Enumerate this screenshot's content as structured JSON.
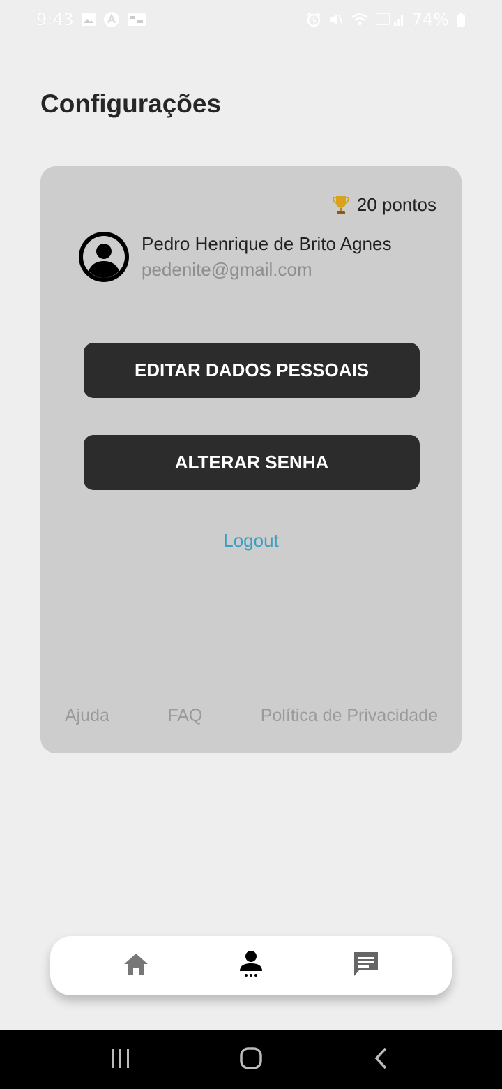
{
  "status_bar": {
    "time": "9:43",
    "battery": "74%"
  },
  "page": {
    "title": "Configurações"
  },
  "profile": {
    "points": "20 pontos",
    "name": "Pedro Henrique de Brito Agnes",
    "email": "pedenite@gmail.com"
  },
  "actions": {
    "edit_label": "EDITAR DADOS PESSOAIS",
    "password_label": "ALTERAR SENHA",
    "logout_label": "Logout"
  },
  "footer": {
    "help": "Ajuda",
    "faq": "FAQ",
    "privacy": "Política de Privacidade"
  },
  "bottom_nav": {
    "items": [
      "home-icon",
      "person-icon",
      "chat-icon"
    ],
    "active": "person-icon"
  },
  "colors": {
    "background": "#eeeeee",
    "card": "#cdcdcd",
    "button": "#2c2c2c",
    "link": "#3b9ec4",
    "muted": "#9a9a9a"
  }
}
